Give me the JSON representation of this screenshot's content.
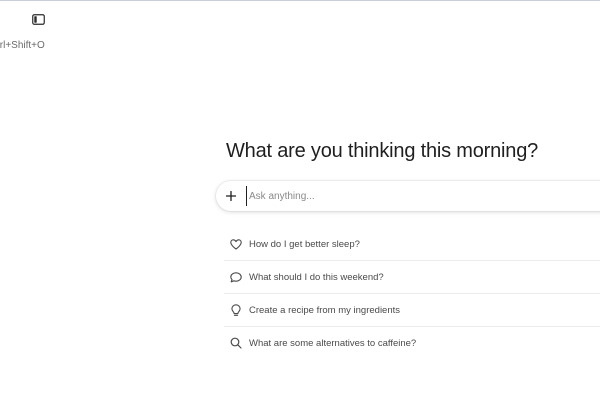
{
  "header": {
    "sidebar_toggle_icon": "sidebar-panel-icon",
    "shortcut_hint": "trl+Shift+O"
  },
  "main": {
    "heading": "What are you thinking this morning?",
    "composer": {
      "add_icon": "plus-icon",
      "placeholder": "Ask anything...",
      "value": ""
    },
    "suggestions": [
      {
        "icon": "heart-icon",
        "label": "How do I get better sleep?"
      },
      {
        "icon": "chat-bubble-icon",
        "label": "What should I do this weekend?"
      },
      {
        "icon": "lightbulb-icon",
        "label": "Create a recipe from my ingredients"
      },
      {
        "icon": "search-icon",
        "label": "What are some alternatives to caffeine?"
      }
    ]
  },
  "colors": {
    "text_primary": "#1f1f1f",
    "text_secondary": "#4a4a4a",
    "placeholder": "#8a8a8a",
    "divider": "#ececec"
  }
}
